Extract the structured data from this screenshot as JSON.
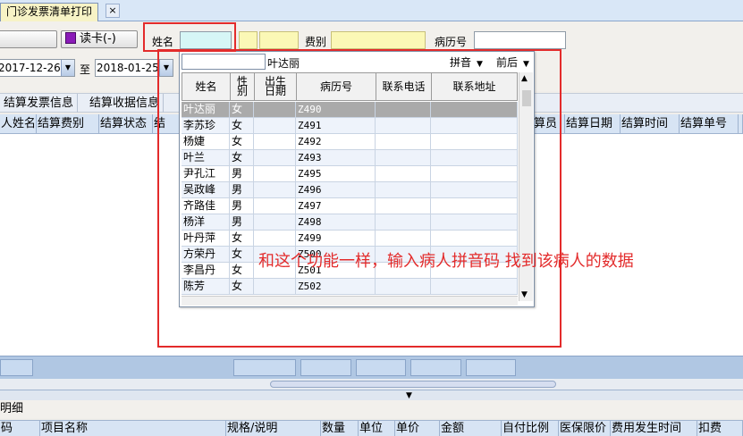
{
  "tab": {
    "label": "门诊发票清单打印",
    "close": "×"
  },
  "query": {
    "read_card_label": "读卡(-)",
    "name_label": "姓名",
    "name_value": "",
    "sex_value": "",
    "age_value": "",
    "fee_label": "费别",
    "fee_value": "",
    "record_label": "病历号",
    "record_value": "",
    "date_from": "2017-12-26",
    "date_to_label": "至",
    "date_to": "2018-01-25"
  },
  "result_tabs": [
    "结算发票信息",
    "结算收据信息"
  ],
  "grid_headers_left": [
    "人姓名",
    "结算费别",
    "结算状态",
    "结"
  ],
  "grid_headers_right": [
    "算员",
    "结算日期",
    "结算时间",
    "结算单号",
    ""
  ],
  "detail": {
    "title": "明细",
    "headers": [
      "码",
      "项目名称",
      "规格/说明",
      "数量",
      "单位",
      "单价",
      "金额",
      "自付比例",
      "医保限价",
      "费用发生时间",
      "扣费"
    ]
  },
  "popup": {
    "search_value": "",
    "name_display": "叶达丽",
    "pinyin_label": "拼音",
    "front_back_label": "前后",
    "headers": [
      "姓名",
      "性别",
      "出生日期",
      "病历号",
      "联系电话",
      "联系地址"
    ],
    "rows": [
      {
        "name": "叶达丽",
        "sex": "女",
        "birth": "",
        "record": "Z490",
        "phone": "",
        "address": ""
      },
      {
        "name": "李苏珍",
        "sex": "女",
        "birth": "",
        "record": "Z491",
        "phone": "",
        "address": ""
      },
      {
        "name": "杨婕",
        "sex": "女",
        "birth": "",
        "record": "Z492",
        "phone": "",
        "address": ""
      },
      {
        "name": "叶兰",
        "sex": "女",
        "birth": "",
        "record": "Z493",
        "phone": "",
        "address": ""
      },
      {
        "name": "尹孔江",
        "sex": "男",
        "birth": "",
        "record": "Z495",
        "phone": "",
        "address": ""
      },
      {
        "name": "吴政峰",
        "sex": "男",
        "birth": "",
        "record": "Z496",
        "phone": "",
        "address": ""
      },
      {
        "name": "齐路佳",
        "sex": "男",
        "birth": "",
        "record": "Z497",
        "phone": "",
        "address": ""
      },
      {
        "name": "杨洋",
        "sex": "男",
        "birth": "",
        "record": "Z498",
        "phone": "",
        "address": ""
      },
      {
        "name": "叶丹萍",
        "sex": "女",
        "birth": "",
        "record": "Z499",
        "phone": "",
        "address": ""
      },
      {
        "name": "方荣丹",
        "sex": "女",
        "birth": "",
        "record": "Z500",
        "phone": "",
        "address": ""
      },
      {
        "name": "李昌丹",
        "sex": "女",
        "birth": "",
        "record": "Z501",
        "phone": "",
        "address": ""
      },
      {
        "name": "陈芳",
        "sex": "女",
        "birth": "",
        "record": "Z502",
        "phone": "",
        "address": ""
      }
    ]
  },
  "annotation": "和这个功能一样，输入病人拼音码 找到该病人的数据",
  "colors": {
    "annotation": "#e32b2b",
    "selected_row": "#aaaaaa",
    "header_blue": "#d7e4f4"
  }
}
